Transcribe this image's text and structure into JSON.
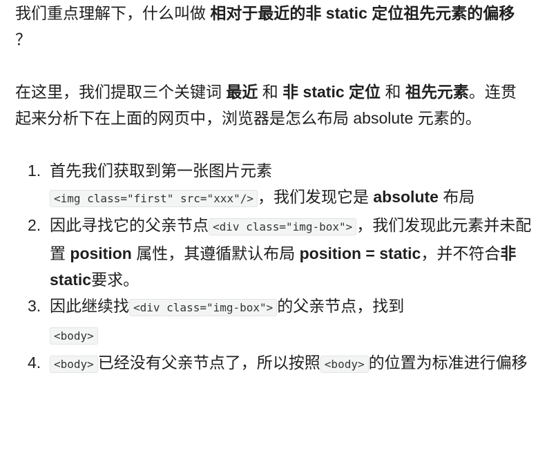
{
  "p1": {
    "t1": "我们重点理解下，什么叫做",
    "b1": "相对于最近的非 static 定位祖先元素的偏移",
    "t2": "？"
  },
  "p2": {
    "t1": "在这里，我们提取三个关键词",
    "b1": "最近",
    "t2": "和",
    "b2": "非 static 定位",
    "t3": "和",
    "b3": "祖先元素",
    "t4": "。连贯起来分析下在上面的网页中，浏览器是怎么布局 absolute 元素的。"
  },
  "list": {
    "i1": {
      "num": "1.",
      "t1": "首先我们获取到第一张图片元素",
      "c1": "<img class=\"first\" src=\"xxx\"/>",
      "t2": "，我们发现它是",
      "b1": "absolute",
      "t3": "布局"
    },
    "i2": {
      "num": "2.",
      "t1": "因此寻找它的父亲节点",
      "c1": "<div class=\"img-box\">",
      "t2": "，我们发现此元素并未配置",
      "b1": "position",
      "t3": "属性，其遵循默认布局",
      "b2": "position = static",
      "t4": "，并不符合",
      "b3": "非 static",
      "t5": "要求。"
    },
    "i3": {
      "num": "3.",
      "t1": "因此继续找",
      "c1": "<div class=\"img-box\">",
      "t2": "的父亲节点，找到",
      "c2": "<body>"
    },
    "i4": {
      "num": "4.",
      "c1": "<body>",
      "t1": "已经没有父亲节点了，所以按照",
      "c2": "<body>",
      "t2": "的位置为标准进行偏移"
    }
  }
}
